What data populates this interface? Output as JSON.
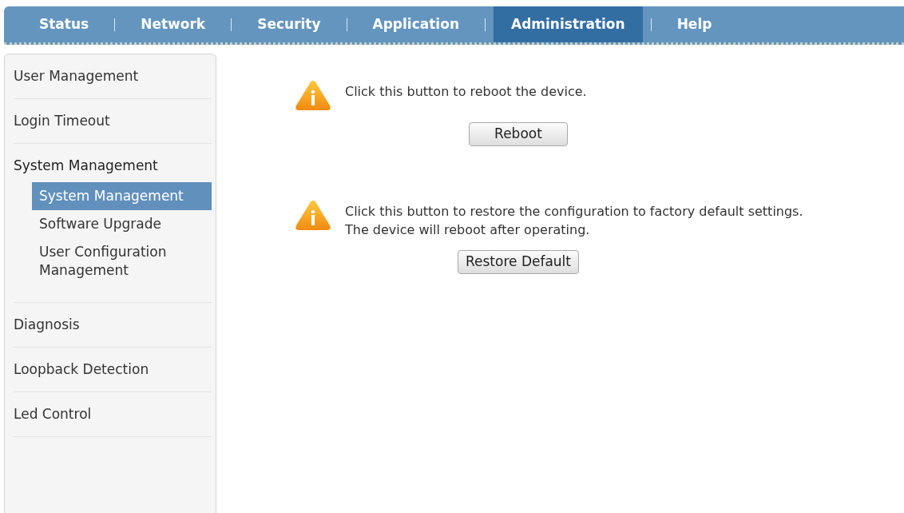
{
  "nav": [
    {
      "label": "Status",
      "selected": false
    },
    {
      "label": "Network",
      "selected": false
    },
    {
      "label": "Security",
      "selected": false
    },
    {
      "label": "Application",
      "selected": false
    },
    {
      "label": "Administration",
      "selected": true
    },
    {
      "label": "Help",
      "selected": false
    }
  ],
  "sidebar": {
    "items": [
      {
        "label": "User Management",
        "expanded": false
      },
      {
        "label": "Login Timeout",
        "expanded": false
      },
      {
        "label": "System Management",
        "expanded": true,
        "children": [
          {
            "label": "System Management",
            "selected": true
          },
          {
            "label": "Software Upgrade",
            "selected": false
          },
          {
            "label": "User Configuration Management",
            "selected": false
          }
        ]
      },
      {
        "label": "Diagnosis",
        "expanded": false
      },
      {
        "label": "Loopback Detection",
        "expanded": false
      },
      {
        "label": "Led Control",
        "expanded": false
      }
    ]
  },
  "actions": [
    {
      "message": "Click this button to reboot the device.",
      "button": "Reboot"
    },
    {
      "message": "Click this button to restore the configuration to factory default settings. The device will reboot after operating.",
      "button": "Restore Default"
    }
  ]
}
